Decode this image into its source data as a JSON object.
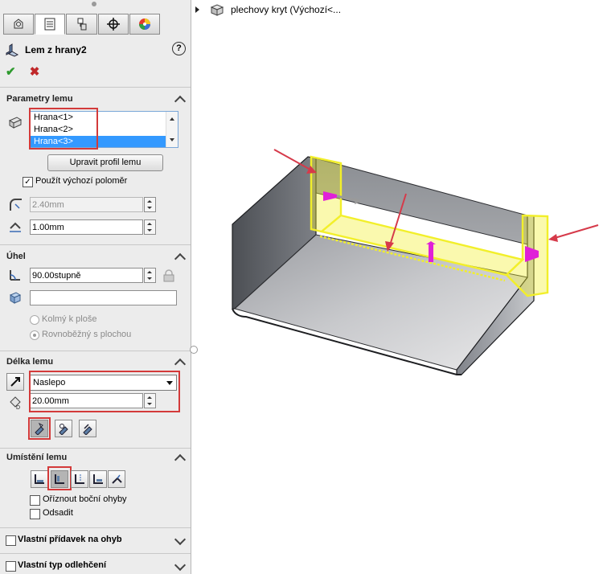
{
  "tabs": [
    "feature-manager",
    "property-manager",
    "configuration-manager",
    "dimxpert-manager",
    "display-manager"
  ],
  "feature": {
    "title": "Lem z hrany2",
    "help": "?"
  },
  "actions": {
    "ok": "✔",
    "cancel": "✖"
  },
  "sections": {
    "params": {
      "title": "Parametry lemu",
      "edges": [
        "Hrana<1>",
        "Hrana<2>",
        "Hrana<3>"
      ],
      "edit_profile": "Upravit profil lemu",
      "use_default_radius": "Použít výchozí poloměr",
      "radius": "2.40mm",
      "gap": "1.00mm"
    },
    "angle": {
      "title": "Úhel",
      "value": "90.00stupně",
      "perpendicular": "Kolmý k ploše",
      "parallel": "Rovnoběžný s plochou"
    },
    "length": {
      "title": "Délka lemu",
      "mode": "Naslepo",
      "value": "20.00mm"
    },
    "position": {
      "title": "Umístění lemu",
      "trim_side": "Oříznout boční ohyby",
      "offset": "Odsadit"
    },
    "custom_allowance": "Vlastní přídavek na ohyb",
    "custom_relief": "Vlastní typ odlehčení"
  },
  "tree": {
    "part": "plechovy kryt  (Výchozí<..."
  },
  "colors": {
    "highlight": "#f2ef2a",
    "arrows": "#d63a4a",
    "handles": "#e020d8",
    "sheet": "#6a6d72"
  }
}
